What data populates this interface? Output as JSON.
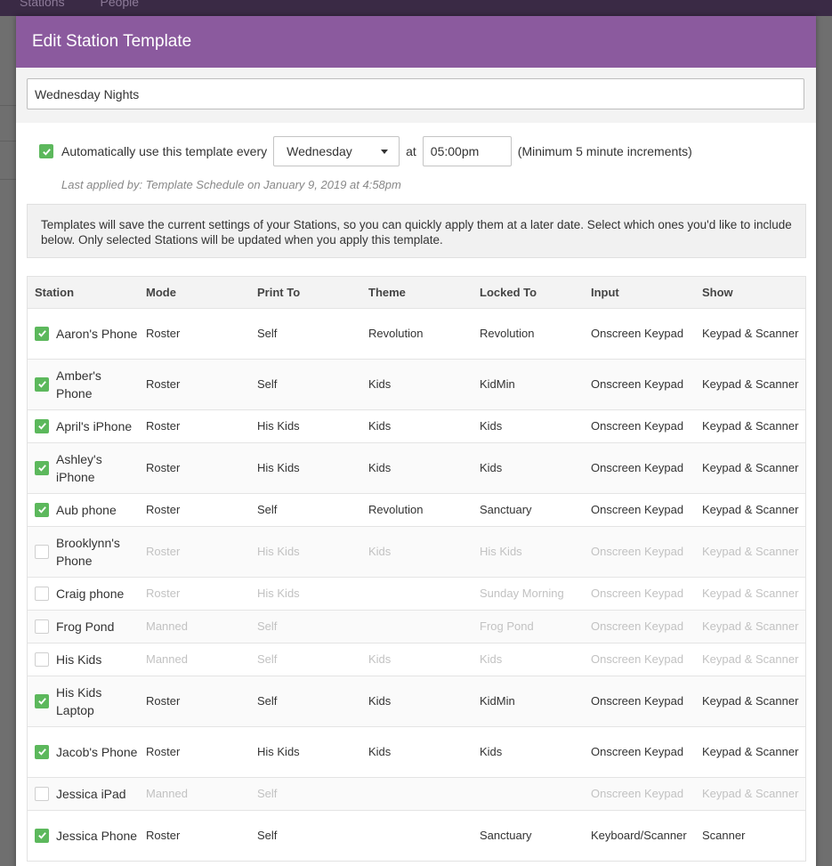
{
  "background_nav": [
    "Stations",
    "People"
  ],
  "modal": {
    "title": "Edit Station Template",
    "template_name": "Wednesday Nights"
  },
  "schedule": {
    "enabled": true,
    "label": "Automatically use this template every",
    "day": "Wednesday",
    "at_label": "at",
    "time": "05:00pm",
    "note": "(Minimum 5 minute increments)",
    "last_applied": "Last applied by: Template Schedule on January 9, 2019 at 4:58pm"
  },
  "info_text": "Templates will save the current settings of your Stations, so you can quickly apply them at a later date. Select which ones you'd like to include below. Only selected Stations will be updated when you apply this template.",
  "table": {
    "headers": [
      "Station",
      "Mode",
      "Print To",
      "Theme",
      "Locked To",
      "Input",
      "Show"
    ],
    "rows": [
      {
        "checked": true,
        "station": "Aaron's Phone",
        "mode": "Roster",
        "print_to": "Self",
        "theme": "Revolution",
        "locked_to": "Revolution",
        "input": "Onscreen Keypad",
        "show": "Keypad & Scanner"
      },
      {
        "checked": true,
        "station": "Amber's Phone",
        "mode": "Roster",
        "print_to": "Self",
        "theme": "Kids",
        "locked_to": "KidMin",
        "input": "Onscreen Keypad",
        "show": "Keypad & Scanner"
      },
      {
        "checked": true,
        "station": "April's iPhone",
        "mode": "Roster",
        "print_to": "His Kids",
        "theme": "Kids",
        "locked_to": "Kids",
        "input": "Onscreen Keypad",
        "show": "Keypad & Scanner"
      },
      {
        "checked": true,
        "station": "Ashley's iPhone",
        "mode": "Roster",
        "print_to": "His Kids",
        "theme": "Kids",
        "locked_to": "Kids",
        "input": "Onscreen Keypad",
        "show": "Keypad & Scanner"
      },
      {
        "checked": true,
        "station": "Aub phone",
        "mode": "Roster",
        "print_to": "Self",
        "theme": "Revolution",
        "locked_to": "Sanctuary",
        "input": "Onscreen Keypad",
        "show": "Keypad & Scanner"
      },
      {
        "checked": false,
        "station": "Brooklynn's Phone",
        "mode": "Roster",
        "print_to": "His Kids",
        "theme": "Kids",
        "locked_to": "His Kids",
        "input": "Onscreen Keypad",
        "show": "Keypad & Scanner"
      },
      {
        "checked": false,
        "station": "Craig phone",
        "mode": "Roster",
        "print_to": "His Kids",
        "theme": "",
        "locked_to": "Sunday Morning",
        "input": "Onscreen Keypad",
        "show": "Keypad & Scanner"
      },
      {
        "checked": false,
        "station": "Frog Pond",
        "mode": "Manned",
        "print_to": "Self",
        "theme": "",
        "locked_to": "Frog Pond",
        "input": "Onscreen Keypad",
        "show": "Keypad & Scanner"
      },
      {
        "checked": false,
        "station": "His Kids",
        "mode": "Manned",
        "print_to": "Self",
        "theme": "Kids",
        "locked_to": "Kids",
        "input": "Onscreen Keypad",
        "show": "Keypad & Scanner"
      },
      {
        "checked": true,
        "station": "His Kids Laptop",
        "mode": "Roster",
        "print_to": "Self",
        "theme": "Kids",
        "locked_to": "KidMin",
        "input": "Onscreen Keypad",
        "show": "Keypad & Scanner"
      },
      {
        "checked": true,
        "station": "Jacob's Phone",
        "mode": "Roster",
        "print_to": "His Kids",
        "theme": "Kids",
        "locked_to": "Kids",
        "input": "Onscreen Keypad",
        "show": "Keypad & Scanner"
      },
      {
        "checked": false,
        "station": "Jessica iPad",
        "mode": "Manned",
        "print_to": "Self",
        "theme": "",
        "locked_to": "",
        "input": "Onscreen Keypad",
        "show": "Keypad & Scanner"
      },
      {
        "checked": true,
        "station": "Jessica Phone",
        "mode": "Roster",
        "print_to": "Self",
        "theme": "",
        "locked_to": "Sanctuary",
        "input": "Keyboard/Scanner",
        "show": "Scanner"
      }
    ]
  },
  "colors": {
    "header_purple": "#8b5a9e",
    "check_green": "#5cb85c",
    "dim_text": "#c2c2c2"
  }
}
